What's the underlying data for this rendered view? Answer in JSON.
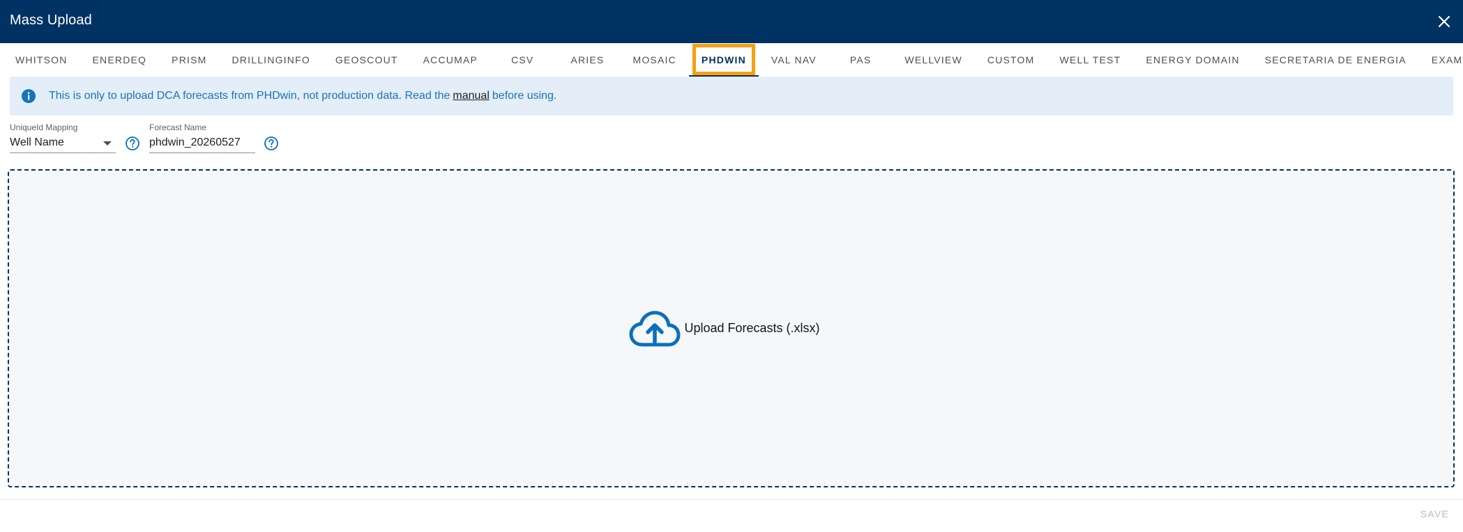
{
  "header": {
    "title": "Mass Upload",
    "close_icon": "close-icon"
  },
  "tabs": [
    {
      "label": "WHITSON"
    },
    {
      "label": "ENERDEQ"
    },
    {
      "label": "PRISM"
    },
    {
      "label": "DRILLINGINFO"
    },
    {
      "label": "GEOSCOUT"
    },
    {
      "label": "ACCUMAP"
    },
    {
      "label": "CSV"
    },
    {
      "label": "ARIES"
    },
    {
      "label": "MOSAIC"
    },
    {
      "label": "PHDWIN",
      "active": true
    },
    {
      "label": "VAL NAV"
    },
    {
      "label": "PAS"
    },
    {
      "label": "WELLVIEW"
    },
    {
      "label": "CUSTOM"
    },
    {
      "label": "WELL TEST"
    },
    {
      "label": "ENERGY DOMAIN"
    },
    {
      "label": "SECRETARIA DE ENERGIA"
    },
    {
      "label": "EXAMPLES"
    }
  ],
  "info": {
    "icon": "info-icon",
    "text_before": "This is only to upload DCA forecasts from PHDwin, not production data. Read the",
    "link_text": "manual",
    "text_after": "before using."
  },
  "uid_mapping": {
    "label": "UniqueId Mapping",
    "value": "Well Name"
  },
  "forecast_name": {
    "label": "Forecast Name",
    "value": "phdwin_20260527"
  },
  "dropzone": {
    "icon": "cloud-upload-icon",
    "label": "Upload Forecasts (.xlsx)"
  },
  "footer": {
    "save_label": "SAVE"
  },
  "colors": {
    "header_bg": "#003263",
    "active_highlight": "#f5a011",
    "info_bg": "#e3eef8",
    "info_text": "#1a73b8",
    "accent": "#0a6fbd"
  }
}
